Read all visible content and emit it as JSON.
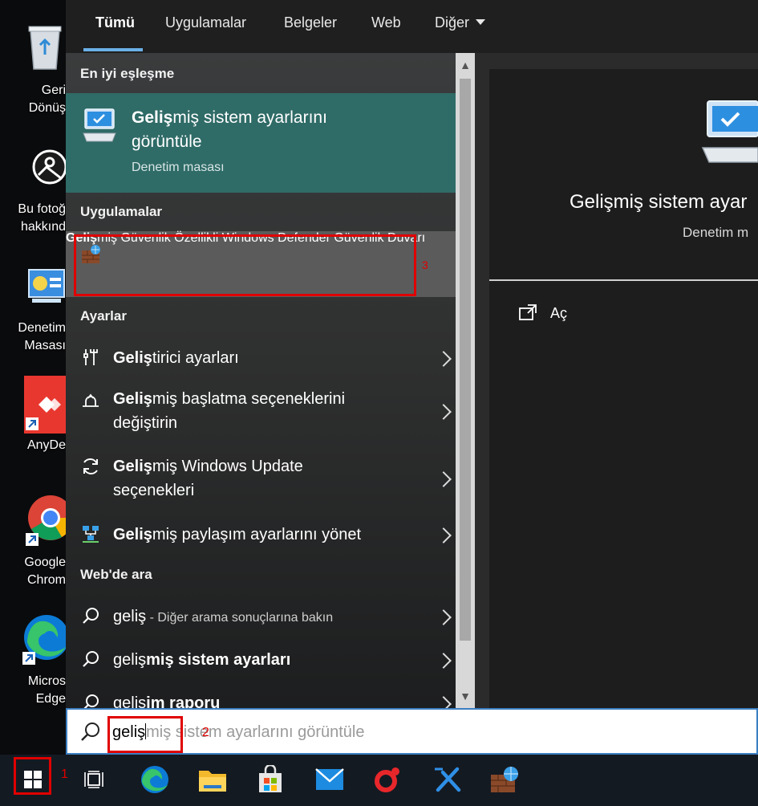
{
  "desktop": {
    "icons": [
      {
        "name": "recycle-bin",
        "label": "Geri\nDönüş"
      },
      {
        "name": "photo",
        "label": "Bu fotoğ\nhakkınd"
      },
      {
        "name": "control-panel",
        "label": "Denetim\nMasası"
      },
      {
        "name": "anydesk",
        "label": "AnyDe"
      },
      {
        "name": "chrome",
        "label": "Google\nChrom"
      },
      {
        "name": "edge",
        "label": "Micros\nEdge"
      }
    ]
  },
  "tabs": [
    {
      "label": "Tümü",
      "active": true
    },
    {
      "label": "Uygulamalar"
    },
    {
      "label": "Belgeler"
    },
    {
      "label": "Web"
    },
    {
      "label": "Diğer"
    }
  ],
  "results": {
    "best_match_title": "En iyi eşleşme",
    "best_match": {
      "title_bold": "Geliş",
      "title_rest": "miş sistem ayarlarını görüntüle",
      "subtitle": "Denetim masası"
    },
    "apps_title": "Uygulamalar",
    "apps": [
      {
        "bold": "Geliş",
        "rest": "miş Güvenlik Özellikli Windows Defender Güvenlik Duvarı"
      }
    ],
    "settings_title": "Ayarlar",
    "settings": [
      {
        "bold": "Geliş",
        "rest": "tirici ayarları",
        "icon": "developer-icon"
      },
      {
        "bold": "Geliş",
        "rest": "miş başlatma seçeneklerini değiştirin",
        "icon": "startup-icon"
      },
      {
        "bold": "Geliş",
        "rest": "miş Windows Update seçenekleri",
        "icon": "update-icon"
      },
      {
        "bold": "Geliş",
        "rest": "miş paylaşım ayarlarını yönet",
        "icon": "sharing-icon"
      }
    ],
    "web_title": "Web'de ara",
    "web": [
      {
        "normal": "geliş",
        "hint": " - Diğer arama sonuçlarına bakın"
      },
      {
        "normal": "geliş",
        "bold": "miş sistem ayarları"
      },
      {
        "normal": "geliş",
        "bold": "im raporu"
      }
    ]
  },
  "preview": {
    "title": "Gelişmiş sistem ayar",
    "subtitle": "Denetim m",
    "open_label": "Aç"
  },
  "search": {
    "typed": "geliş",
    "completion": "miş sistem ayarlarını görüntüle"
  },
  "annotations": [
    "1",
    "2",
    "3"
  ],
  "colors": {
    "best_match_bg": "#2f6b67",
    "annotation_red": "#e00000",
    "tab_underline": "#6ab0e8"
  }
}
